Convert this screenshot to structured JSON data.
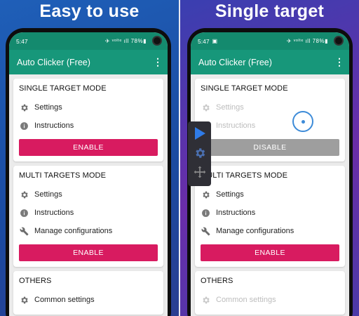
{
  "left": {
    "headline": "Easy to use",
    "status": {
      "time": "5:47",
      "icons": "✈ ᵛᵒˡᵗᵉ ıll 78%▮"
    },
    "app_title": "Auto Clicker (Free)",
    "single": {
      "title": "SINGLE TARGET MODE",
      "settings": "Settings",
      "instructions": "Instructions",
      "button": "ENABLE"
    },
    "multi": {
      "title": "MULTI TARGETS MODE",
      "settings": "Settings",
      "instructions": "Instructions",
      "manage": "Manage configurations",
      "button": "ENABLE"
    },
    "others": {
      "title": "OTHERS",
      "common": "Common settings"
    }
  },
  "right": {
    "headline": "Single target",
    "status": {
      "time": "5:47",
      "icons": "✈ ᵛᵒˡᵗᵉ ıll 78%▮"
    },
    "app_title": "Auto Clicker (Free)",
    "single": {
      "title": "SINGLE TARGET MODE",
      "settings": "Settings",
      "instructions": "Instructions",
      "button": "DISABLE"
    },
    "multi": {
      "title": "MULTI TARGETS MODE",
      "settings": "Settings",
      "instructions": "Instructions",
      "manage": "Manage configurations",
      "button": "ENABLE"
    },
    "others": {
      "title": "OTHERS",
      "common": "Common settings"
    }
  },
  "colors": {
    "appbar": "#17977a",
    "statusbar": "#148a6e",
    "enable_button": "#d81b60",
    "disable_button": "#9e9e9e",
    "play_accent": "#2f7be8"
  },
  "icons": {
    "settings": "gear-icon",
    "instructions": "info-icon",
    "manage": "wrench-icon",
    "menu": "overflow-menu-icon",
    "overlay": [
      "play-icon",
      "gear-icon",
      "move-icon"
    ],
    "target": "target-icon"
  }
}
